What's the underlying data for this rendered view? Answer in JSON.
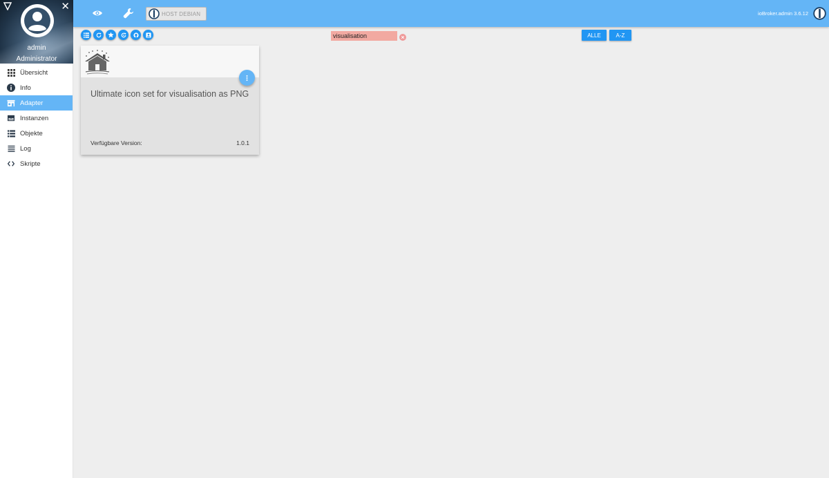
{
  "sidebar": {
    "user_name": "admin",
    "user_role": "Administrator",
    "items": [
      {
        "label": "Übersicht",
        "icon": "grid-icon"
      },
      {
        "label": "Info",
        "icon": "info-icon"
      },
      {
        "label": "Adapter",
        "icon": "store-icon",
        "active": true
      },
      {
        "label": "Instanzen",
        "icon": "instances-icon"
      },
      {
        "label": "Objekte",
        "icon": "list-icon"
      },
      {
        "label": "Log",
        "icon": "lines-icon"
      },
      {
        "label": "Skripte",
        "icon": "code-icon"
      }
    ]
  },
  "topbar": {
    "host_label": "HOST DEBIAN",
    "version": "ioBroker.admin 3.6.12"
  },
  "toolbar": {
    "search_value": "visualisation",
    "filter_all": "ALLE",
    "filter_az": "A-Z"
  },
  "card": {
    "title": "Ultimate icon set for visualisation as PNG",
    "version_label": "Verfügbare Version:",
    "version_value": "1.0.1"
  },
  "colors": {
    "primary": "#64b5f6",
    "accent": "#2196f3",
    "search_bg": "#f2a9a1"
  }
}
